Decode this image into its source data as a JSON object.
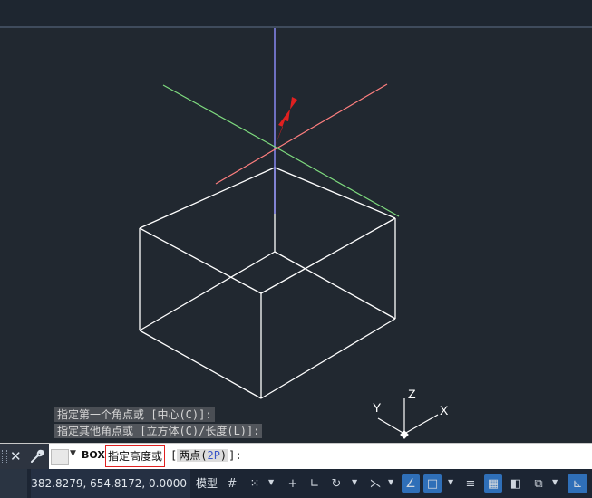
{
  "history": {
    "line1": "指定第一个角点或 [中心(C)]:",
    "line2": "指定其他角点或 [立方体(C)/长度(L)]:"
  },
  "cmdline": {
    "command": "BOX",
    "prompt": "指定高度或",
    "open": "[",
    "option_pre": "两点(",
    "option_key": "2P",
    "option_post": ")",
    "close": "]:"
  },
  "ucs": {
    "x": "X",
    "y": "Y",
    "z": "Z"
  },
  "status": {
    "coordinates": "382.8279, 654.8172, 0.0000",
    "model": "模型"
  },
  "colors": {
    "background": "#212830",
    "x_axis": "#ff7f7f",
    "y_axis": "#7fdc7f",
    "z_axis": "#8f8fff",
    "arrow": "#e02020"
  }
}
